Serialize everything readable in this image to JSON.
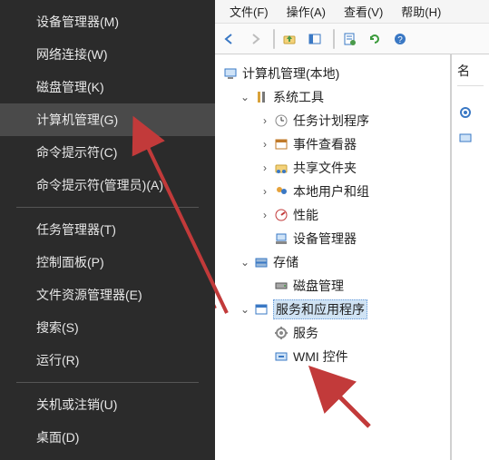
{
  "context_menu": {
    "group1": [
      "设备管理器(M)",
      "网络连接(W)",
      "磁盘管理(K)",
      "计算机管理(G)",
      "命令提示符(C)",
      "命令提示符(管理员)(A)"
    ],
    "group1_highlight_index": 3,
    "group2": [
      "任务管理器(T)",
      "控制面板(P)",
      "文件资源管理器(E)",
      "搜索(S)",
      "运行(R)"
    ],
    "group3": [
      "关机或注销(U)",
      "桌面(D)"
    ]
  },
  "menu_bar": {
    "file": "文件(F)",
    "action": "操作(A)",
    "view": "查看(V)",
    "help": "帮助(H)"
  },
  "tree": {
    "root": "计算机管理(本地)",
    "system_tools": {
      "label": "系统工具",
      "children": {
        "task_scheduler": "任务计划程序",
        "event_viewer": "事件查看器",
        "shared_folders": "共享文件夹",
        "local_users": "本地用户和组",
        "performance": "性能",
        "device_manager": "设备管理器"
      }
    },
    "storage": {
      "label": "存储",
      "children": {
        "disk_management": "磁盘管理"
      }
    },
    "services_apps": {
      "label": "服务和应用程序",
      "children": {
        "services": "服务",
        "wmi": "WMI 控件"
      }
    }
  },
  "right_panel": {
    "header": "名"
  },
  "icons": {
    "back": "back-arrow-icon",
    "forward": "forward-arrow-icon",
    "up": "up-folder-icon",
    "props": "properties-icon",
    "refresh": "refresh-icon",
    "help": "help-icon"
  }
}
